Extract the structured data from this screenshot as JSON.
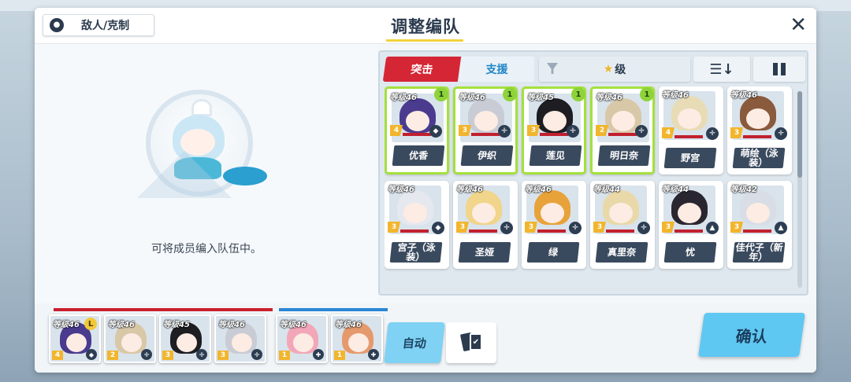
{
  "header": {
    "enemy_counter_label": "敌人/克制",
    "title": "调整编队",
    "close_glyph": "✕"
  },
  "left": {
    "hint": "可将成员编入队伍中。"
  },
  "roster": {
    "tabs": [
      {
        "label": "突击",
        "active": true
      },
      {
        "label": "支援",
        "active": false
      }
    ],
    "filter_label": "级",
    "filter_star": "★",
    "sort_glyph": "☰↓",
    "students": [
      {
        "name": "优香",
        "level": "等级46",
        "star": "4",
        "selected": true,
        "badge": "1",
        "hair": "#4a3b8f",
        "role": "◆"
      },
      {
        "name": "伊织",
        "level": "等级46",
        "star": "3",
        "selected": true,
        "badge": "1",
        "hair": "#c9ccd4",
        "role": "✛"
      },
      {
        "name": "莲见",
        "level": "等级45",
        "star": "3",
        "selected": true,
        "badge": "1",
        "hair": "#1d1d22",
        "role": "✛"
      },
      {
        "name": "明日奈",
        "level": "等级46",
        "star": "2",
        "selected": true,
        "badge": "1",
        "hair": "#d9c8a8",
        "role": "✛"
      },
      {
        "name": "野宫",
        "level": "等级46",
        "star": "4",
        "selected": false,
        "badge": "",
        "hair": "#e8dcb6",
        "role": "✛"
      },
      {
        "name": "萌绘（泳装）",
        "level": "等级46",
        "star": "3",
        "selected": false,
        "badge": "",
        "hair": "#8a5a3c",
        "role": "✛"
      },
      {
        "name": "宫子（泳装）",
        "level": "等级46",
        "star": "3",
        "selected": false,
        "badge": "",
        "hair": "#e6e8ef",
        "role": "◆"
      },
      {
        "name": "圣娅",
        "level": "等级46",
        "star": "3",
        "selected": false,
        "badge": "",
        "hair": "#f0d58a",
        "role": "✛"
      },
      {
        "name": "绿",
        "level": "等级46",
        "star": "3",
        "selected": false,
        "badge": "",
        "hair": "#e8a23a",
        "role": "✛"
      },
      {
        "name": "真里奈",
        "level": "等级44",
        "star": "3",
        "selected": false,
        "badge": "",
        "hair": "#e9d9a8",
        "role": "✛"
      },
      {
        "name": "忧",
        "level": "等级44",
        "star": "3",
        "selected": false,
        "badge": "",
        "hair": "#2a2630",
        "role": "▲"
      },
      {
        "name": "佳代子（新年）",
        "level": "等级42",
        "star": "3",
        "selected": false,
        "badge": "",
        "hair": "#d8dde6",
        "role": "▲"
      }
    ]
  },
  "team": {
    "slots": [
      {
        "level": "等级46",
        "star": "4",
        "hair": "#4a3b8f",
        "leader": true,
        "role": "◆"
      },
      {
        "level": "等级46",
        "star": "2",
        "hair": "#d9c8a8",
        "leader": false,
        "role": "✛"
      },
      {
        "level": "等级45",
        "star": "3",
        "hair": "#1d1d22",
        "leader": false,
        "role": "✛"
      },
      {
        "level": "等级46",
        "star": "3",
        "hair": "#c9ccd4",
        "leader": false,
        "role": "✛"
      },
      {
        "level": "等级46",
        "star": "1",
        "hair": "#f2a7b8",
        "leader": false,
        "role": "✚"
      },
      {
        "level": "等级46",
        "star": "1",
        "hair": "#e59a6e",
        "leader": false,
        "role": "✚"
      }
    ],
    "leader_glyph": "L",
    "auto_label": "自动",
    "confirm_label": "确认"
  },
  "colors": {
    "accent_red": "#d52636",
    "accent_blue": "#5fc8f2",
    "selected_border": "#a4e03c"
  }
}
